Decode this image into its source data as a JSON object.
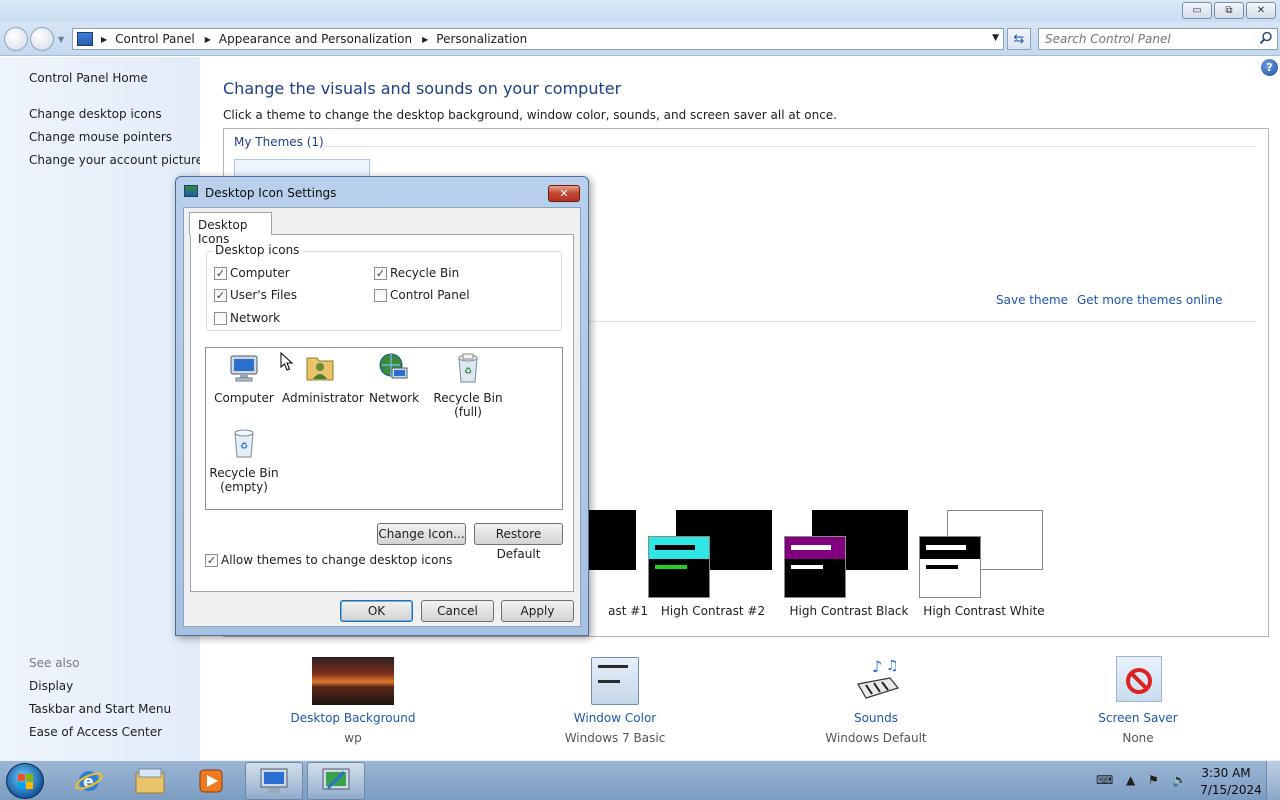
{
  "window": {
    "caption_minimize": "▭",
    "caption_maximize": "⧉",
    "caption_close": "✕"
  },
  "address": {
    "crumbs": [
      "Control Panel",
      "Appearance and Personalization",
      "Personalization"
    ],
    "search_placeholder": "Search Control Panel"
  },
  "sidebar": {
    "home": "Control Panel Home",
    "links": [
      "Change desktop icons",
      "Change mouse pointers",
      "Change your account picture"
    ],
    "see_also_label": "See also",
    "see_also": [
      "Display",
      "Taskbar and Start Menu",
      "Ease of Access Center"
    ]
  },
  "main": {
    "title": "Change the visuals and sounds on your computer",
    "subtitle": "Click a theme to change the desktop background, window color, sounds, and screen saver all at once.",
    "my_themes": "My Themes (1)",
    "save_theme": "Save theme",
    "get_more_themes": "Get more themes online",
    "high_contrast_themes": [
      {
        "label": "ast #1",
        "big": "#000000",
        "small": "#000000",
        "bar1": "#ffffff",
        "bar2": "#ffffff"
      },
      {
        "label": "High Contrast #2",
        "big": "#000000",
        "small": "#000000",
        "header": "#2ee6e6",
        "bar1": "#000000",
        "bar2": "#22d022"
      },
      {
        "label": "High Contrast Black",
        "big": "#000000",
        "small": "#000000",
        "header": "#800080",
        "bar1": "#ffffff",
        "bar2": "#ffffff"
      },
      {
        "label": "High Contrast White",
        "big": "#ffffff",
        "small": "#ffffff",
        "header": "#000000",
        "bar1": "#ffffff",
        "bar2": "#000000"
      }
    ]
  },
  "settings": [
    {
      "link": "Desktop Background",
      "value": "wp"
    },
    {
      "link": "Window Color",
      "value": "Windows 7 Basic"
    },
    {
      "link": "Sounds",
      "value": "Windows Default"
    },
    {
      "link": "Screen Saver",
      "value": "None"
    }
  ],
  "dialog": {
    "title": "Desktop Icon Settings",
    "close": "✕",
    "tab": "Desktop Icons",
    "group_label": "Desktop icons",
    "checkboxes": [
      {
        "label": "Computer",
        "checked": true
      },
      {
        "label": "Recycle Bin",
        "checked": true
      },
      {
        "label": "User's Files",
        "checked": true
      },
      {
        "label": "Control Panel",
        "checked": false
      },
      {
        "label": "Network",
        "checked": false
      }
    ],
    "icons": [
      {
        "label": "Computer",
        "icon": "computer-icon"
      },
      {
        "label": "Administrator",
        "icon": "user-folder-icon"
      },
      {
        "label": "Network",
        "icon": "network-icon"
      },
      {
        "label": "Recycle Bin (full)",
        "icon": "recycle-bin-full-icon"
      },
      {
        "label": "Recycle Bin (empty)",
        "icon": "recycle-bin-empty-icon"
      }
    ],
    "change_icon": "Change Icon...",
    "restore_default": "Restore Default",
    "allow_themes": "Allow themes to change desktop icons",
    "allow_themes_checked": true,
    "ok": "OK",
    "cancel": "Cancel",
    "apply": "Apply"
  },
  "taskbar": {
    "time": "3:30 AM",
    "date": "7/15/2024"
  }
}
